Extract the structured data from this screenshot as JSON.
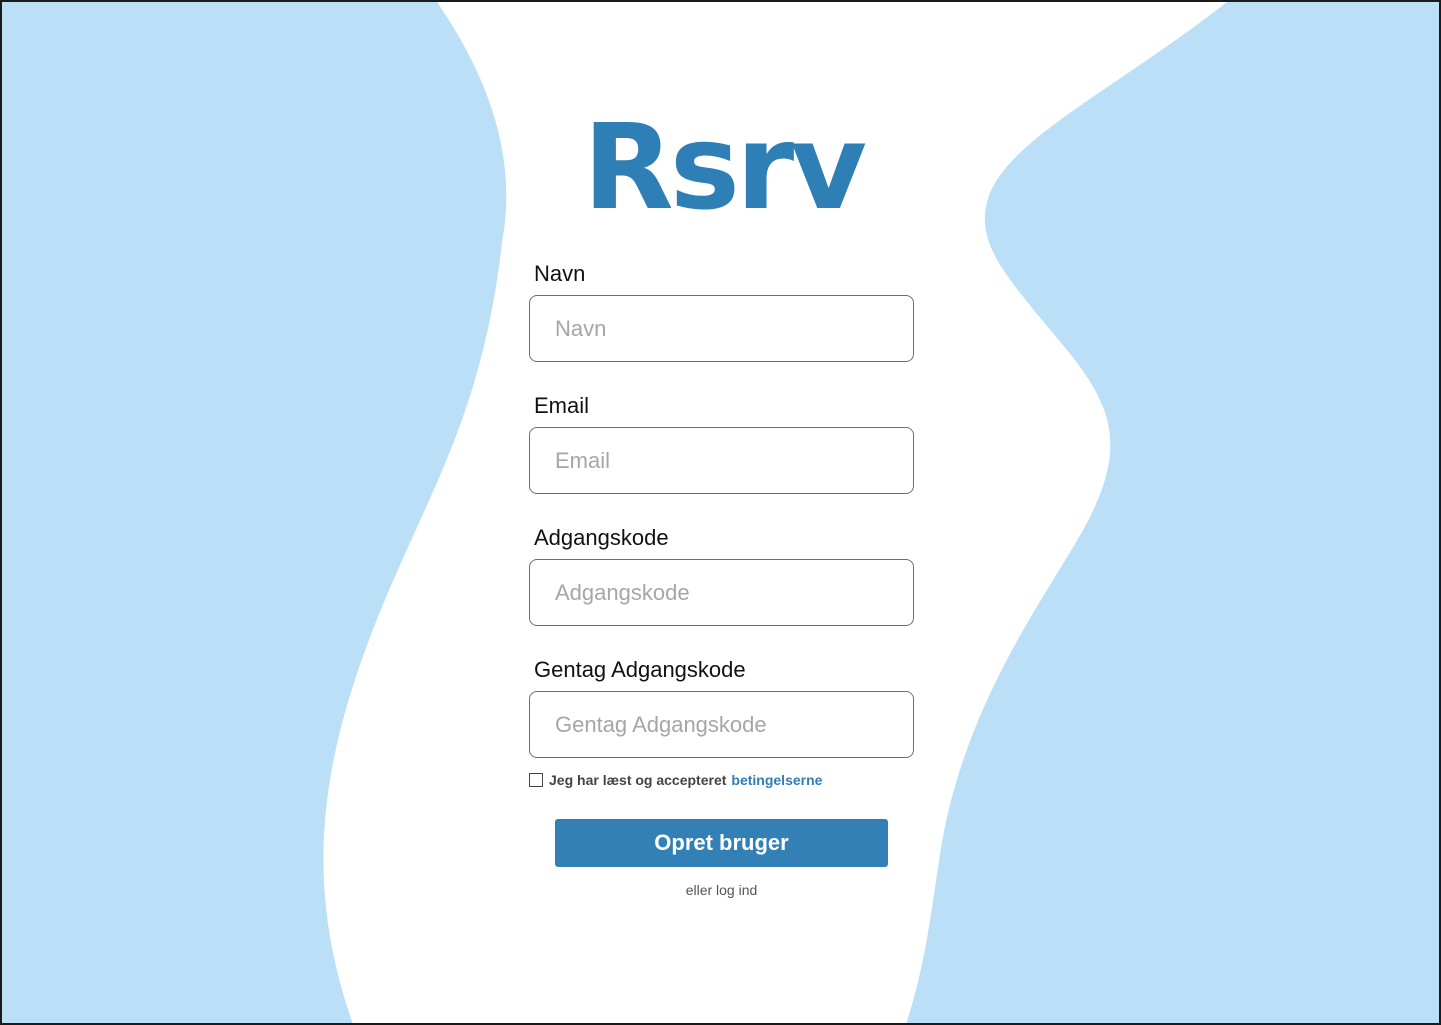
{
  "app": {
    "logo": "Rsrv"
  },
  "form": {
    "name": {
      "label": "Navn",
      "placeholder": "Navn"
    },
    "email": {
      "label": "Email",
      "placeholder": "Email"
    },
    "password": {
      "label": "Adgangskode",
      "placeholder": "Adgangskode"
    },
    "password_repeat": {
      "label": "Gentag Adgangskode",
      "placeholder": "Gentag Adgangskode"
    },
    "terms": {
      "text": "Jeg har læst og accepteret",
      "link": "betingelserne",
      "checked": false
    },
    "submit_label": "Opret bruger",
    "login_link": "eller log ind"
  },
  "colors": {
    "accent": "#2f7fb7",
    "button": "#3380b7",
    "background_shape": "#bbdff7"
  }
}
